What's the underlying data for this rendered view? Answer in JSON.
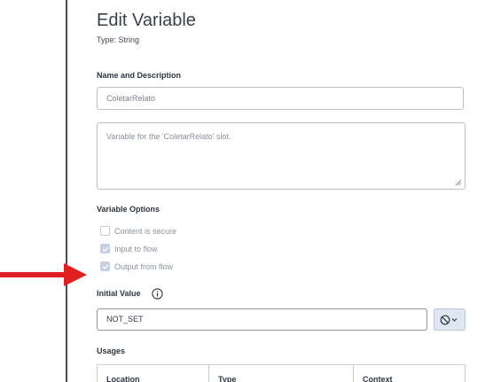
{
  "editor": {
    "title": "Edit Variable",
    "type_label": "Type: String"
  },
  "name_section": {
    "label": "Name and Description",
    "name_value": "ColetarRelato",
    "description_value": "Variable for the 'ColetarRelato' slot."
  },
  "options_section": {
    "label": "Variable Options",
    "options": [
      {
        "label": "Content is secure",
        "checked": false
      },
      {
        "label": "Input to flow",
        "checked": true
      },
      {
        "label": "Output from flow",
        "checked": true
      }
    ]
  },
  "initial_value": {
    "label": "Initial Value",
    "value": "NOT_SET",
    "info_icon": "info-icon",
    "null_button_icon": "no-symbol-icon"
  },
  "usages": {
    "label": "Usages",
    "columns": [
      "Location",
      "Type",
      "Context"
    ]
  },
  "annotation": {
    "arrow_color": "#e02020"
  },
  "colors": {
    "checkbox_checked": "#c5d0e2",
    "null_button_bg": "#dfe7f3"
  }
}
